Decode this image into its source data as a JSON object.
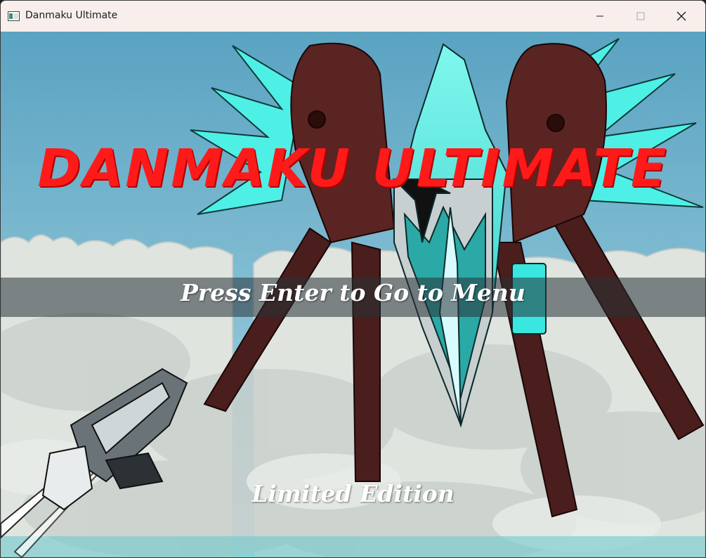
{
  "window": {
    "title": "Danmaku Ultimate",
    "app_icon": "window-app-icon",
    "controls": [
      "minimize-icon",
      "maximize-icon",
      "close-icon"
    ]
  },
  "title_screen": {
    "game_title": "DANMAKU ULTIMATE",
    "prompt": "Press Enter to Go to Menu",
    "edition": "Limited Edition"
  },
  "colors": {
    "sky": "#5aa7c5",
    "title_red": "#ff1a1a",
    "boss_cyan": "#4ef0e6",
    "boss_brown": "#4a1e1c",
    "text_white": "#ffffff"
  }
}
